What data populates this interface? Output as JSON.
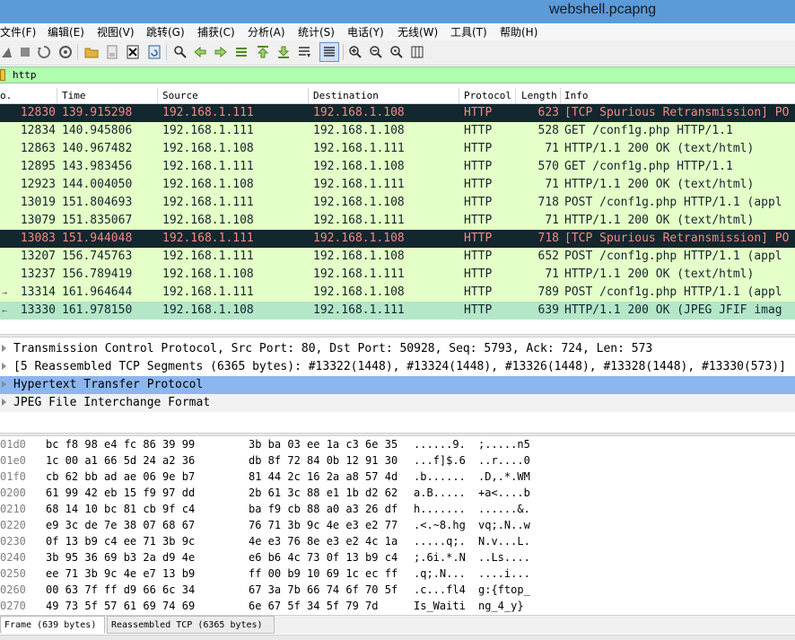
{
  "window": {
    "title": "webshell.pcapng"
  },
  "menu": [
    "文件(F)",
    "编辑(E)",
    "视图(V)",
    "跳转(G)",
    "捕获(C)",
    "分析(A)",
    "统计(S)",
    "电话(Y)",
    "无线(W)",
    "工具(T)",
    "帮助(H)"
  ],
  "toolbar": {
    "icons": [
      "shark-fin-icon",
      "stop-capture-icon",
      "restart-capture-icon",
      "capture-options-icon",
      "open-file-icon",
      "save-file-icon",
      "close-file-icon",
      "reload-file-icon",
      "find-packet-icon",
      "go-back-icon",
      "go-forward-icon",
      "go-to-packet-icon",
      "go-first-icon",
      "go-last-icon",
      "auto-scroll-icon",
      "colorize-icon",
      "zoom-in-icon",
      "zoom-out-icon",
      "zoom-normal-icon",
      "resize-columns-icon"
    ]
  },
  "filter": {
    "value": "http"
  },
  "packet_list": {
    "columns": [
      "o.",
      "Time",
      "Source",
      "Destination",
      "Protocol",
      "Length",
      "Info"
    ],
    "rows": [
      {
        "no": "12830",
        "time": "139.915298",
        "src": "192.168.1.111",
        "dst": "192.168.1.108",
        "proto": "HTTP",
        "len": "623",
        "info": "[TCP Spurious Retransmission] PO",
        "style": "bad"
      },
      {
        "no": "12834",
        "time": "140.945806",
        "src": "192.168.1.111",
        "dst": "192.168.1.108",
        "proto": "HTTP",
        "len": "528",
        "info": "GET /conf1g.php HTTP/1.1",
        "style": "http"
      },
      {
        "no": "12863",
        "time": "140.967482",
        "src": "192.168.1.108",
        "dst": "192.168.1.111",
        "proto": "HTTP",
        "len": "71",
        "info": "HTTP/1.1 200 OK  (text/html)",
        "style": "http"
      },
      {
        "no": "12895",
        "time": "143.983456",
        "src": "192.168.1.111",
        "dst": "192.168.1.108",
        "proto": "HTTP",
        "len": "570",
        "info": "GET /conf1g.php HTTP/1.1",
        "style": "http"
      },
      {
        "no": "12923",
        "time": "144.004050",
        "src": "192.168.1.108",
        "dst": "192.168.1.111",
        "proto": "HTTP",
        "len": "71",
        "info": "HTTP/1.1 200 OK  (text/html)",
        "style": "http"
      },
      {
        "no": "13019",
        "time": "151.804693",
        "src": "192.168.1.111",
        "dst": "192.168.1.108",
        "proto": "HTTP",
        "len": "718",
        "info": "POST /conf1g.php HTTP/1.1  (appl",
        "style": "http"
      },
      {
        "no": "13079",
        "time": "151.835067",
        "src": "192.168.1.108",
        "dst": "192.168.1.111",
        "proto": "HTTP",
        "len": "71",
        "info": "HTTP/1.1 200 OK  (text/html)",
        "style": "http"
      },
      {
        "no": "13083",
        "time": "151.944048",
        "src": "192.168.1.111",
        "dst": "192.168.1.108",
        "proto": "HTTP",
        "len": "718",
        "info": "[TCP Spurious Retransmission] PO",
        "style": "bad"
      },
      {
        "no": "13207",
        "time": "156.745763",
        "src": "192.168.1.111",
        "dst": "192.168.1.108",
        "proto": "HTTP",
        "len": "652",
        "info": "POST /conf1g.php HTTP/1.1  (appl",
        "style": "http"
      },
      {
        "no": "13237",
        "time": "156.789419",
        "src": "192.168.1.108",
        "dst": "192.168.1.111",
        "proto": "HTTP",
        "len": "71",
        "info": "HTTP/1.1 200 OK  (text/html)",
        "style": "http"
      },
      {
        "no": "13314",
        "time": "161.964644",
        "src": "192.168.1.111",
        "dst": "192.168.1.108",
        "proto": "HTTP",
        "len": "789",
        "info": "POST /conf1g.php HTTP/1.1  (appl",
        "style": "http",
        "related": "→"
      },
      {
        "no": "13330",
        "time": "161.978150",
        "src": "192.168.1.108",
        "dst": "192.168.1.111",
        "proto": "HTTP",
        "len": "639",
        "info": "HTTP/1.1 200 OK  (JPEG JFIF imag",
        "style": "selected",
        "related": "←"
      }
    ]
  },
  "details": [
    {
      "text": "Transmission Control Protocol, Src Port: 80, Dst Port: 50928, Seq: 5793, Ack: 724, Len: 573",
      "style": "plain"
    },
    {
      "text": "[5 Reassembled TCP Segments (6365 bytes): #13322(1448), #13324(1448), #13326(1448), #13328(1448), #13330(573)]",
      "style": "plain"
    },
    {
      "text": "Hypertext Transfer Protocol",
      "style": "selected"
    },
    {
      "text": "JPEG File Interchange Format",
      "style": "grey"
    }
  ],
  "bytes": [
    {
      "off": "01d0",
      "h1": "bc f8 98 e4 fc 86 39 99",
      "h2": "3b ba 03 ee 1a c3 6e 35",
      "a1": "......9.",
      "a2": ";.....n5"
    },
    {
      "off": "01e0",
      "h1": "1c 00 a1 66 5d 24 a2 36",
      "h2": "db 8f 72 84 0b 12 91 30",
      "a1": "...f]$.6",
      "a2": "..r....0"
    },
    {
      "off": "01f0",
      "h1": "cb 62 bb ad ae 06 9e b7",
      "h2": "81 44 2c 16 2a a8 57 4d",
      "a1": ".b......",
      "a2": ".D,.*.WM"
    },
    {
      "off": "0200",
      "h1": "61 99 42 eb 15 f9 97 dd",
      "h2": "2b 61 3c 88 e1 1b d2 62",
      "a1": "a.B.....",
      "a2": "+a<....b"
    },
    {
      "off": "0210",
      "h1": "68 14 10 bc 81 cb 9f c4",
      "h2": "ba f9 cb 88 a0 a3 26 df",
      "a1": "h.......",
      "a2": "......&."
    },
    {
      "off": "0220",
      "h1": "e9 3c de 7e 38 07 68 67",
      "h2": "76 71 3b 9c 4e e3 e2 77",
      "a1": ".<.~8.hg",
      "a2": "vq;.N..w"
    },
    {
      "off": "0230",
      "h1": "0f 13 b9 c4 ee 71 3b 9c",
      "h2": "4e e3 76 8e e3 e2 4c 1a",
      "a1": ".....q;.",
      "a2": "N.v...L."
    },
    {
      "off": "0240",
      "h1": "3b 95 36 69 b3 2a d9 4e",
      "h2": "e6 b6 4c 73 0f 13 b9 c4",
      "a1": ";.6i.*.N",
      "a2": "..Ls...."
    },
    {
      "off": "0250",
      "h1": "ee 71 3b 9c 4e e7 13 b9",
      "h2": "ff 00 b9 10 69 1c ec ff",
      "a1": ".q;.N...",
      "a2": "....i..."
    },
    {
      "off": "0260",
      "h1": "00 63 7f ff d9 66 6c 34",
      "h2": "67 3a 7b 66 74 6f 70 5f",
      "a1": ".c...fl4",
      "a2": "g:{ftop_"
    },
    {
      "off": "0270",
      "h1": "49 73 5f 57 61 69 74 69",
      "h2": "6e 67 5f 34 5f 79 7d",
      "a1": "Is_Waiti",
      "a2": "ng_4_y}"
    }
  ],
  "bottom_tabs": [
    "Frame (639 bytes)",
    "Reassembled TCP (6365 bytes)"
  ],
  "colors": {
    "http_row": "#e4ffc7",
    "bad_row_bg": "#12272e",
    "bad_row_fg": "#f78787",
    "selected_row": "#b4e6c8",
    "filter_bg": "#afffaf",
    "detail_selected": "#8cb6ef"
  }
}
